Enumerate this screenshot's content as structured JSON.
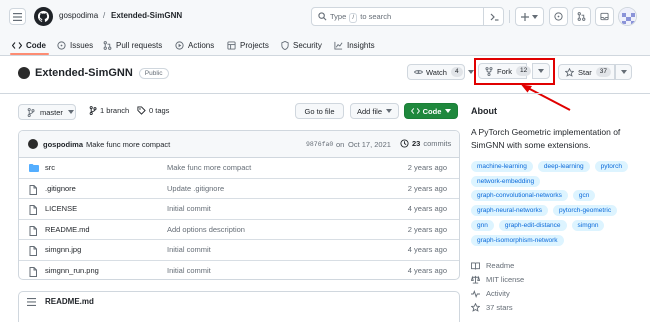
{
  "header": {
    "owner": "gospodima",
    "separator": "/",
    "repo": "Extended-SimGNN",
    "search": {
      "pre": "Type",
      "key": "/",
      "post": "to search"
    }
  },
  "tabs": [
    {
      "label": "Code"
    },
    {
      "label": "Issues"
    },
    {
      "label": "Pull requests"
    },
    {
      "label": "Actions"
    },
    {
      "label": "Projects"
    },
    {
      "label": "Security"
    },
    {
      "label": "Insights"
    }
  ],
  "repo": {
    "name": "Extended-SimGNN",
    "visibility": "Public",
    "watch_label": "Watch",
    "watch_count": "4",
    "fork_label": "Fork",
    "fork_count": "12",
    "star_label": "Star",
    "star_count": "37"
  },
  "toolbar": {
    "branch": "master",
    "branches": "1 branch",
    "tags": "0 tags",
    "goto_file": "Go to file",
    "add_file": "Add file",
    "code": "Code"
  },
  "commit": {
    "author": "gospodima",
    "message": "Make func more compact",
    "hash": "9876fa0",
    "date_prefix": "on",
    "date": "Oct 17, 2021",
    "count": "23",
    "count_label": "commits"
  },
  "files": [
    {
      "name": "src",
      "type": "dir",
      "message": "Make func more compact",
      "age": "2 years ago"
    },
    {
      "name": ".gitignore",
      "type": "file",
      "message": "Update .gitignore",
      "age": "2 years ago"
    },
    {
      "name": "LICENSE",
      "type": "file",
      "message": "Initial commit",
      "age": "4 years ago"
    },
    {
      "name": "README.md",
      "type": "file",
      "message": "Add options description",
      "age": "2 years ago"
    },
    {
      "name": "simgnn.jpg",
      "type": "file",
      "message": "Initial commit",
      "age": "4 years ago"
    },
    {
      "name": "simgnn_run.png",
      "type": "file",
      "message": "Initial commit",
      "age": "4 years ago"
    }
  ],
  "readme": {
    "title": "README.md"
  },
  "about": {
    "heading": "About",
    "description": "A PyTorch Geometric implementation of SimGNN with some extensions.",
    "topics": [
      "machine-learning",
      "deep-learning",
      "pytorch",
      "network-embedding",
      "graph-convolutional-networks",
      "gcn",
      "graph-neural-networks",
      "pytorch-geometric",
      "gnn",
      "graph-edit-distance",
      "simgnn",
      "graph-isomorphism-network"
    ],
    "links": [
      {
        "label": "Readme",
        "icon": "book-icon"
      },
      {
        "label": "MIT license",
        "icon": "law-icon"
      },
      {
        "label": "Activity",
        "icon": "pulse-icon"
      },
      {
        "label": "37 stars",
        "icon": "star-icon"
      }
    ]
  },
  "colors": {
    "accent": "#0969da",
    "green": "#1f883d",
    "highlight": "#e00000",
    "tab_underline": "#fd8c73"
  }
}
